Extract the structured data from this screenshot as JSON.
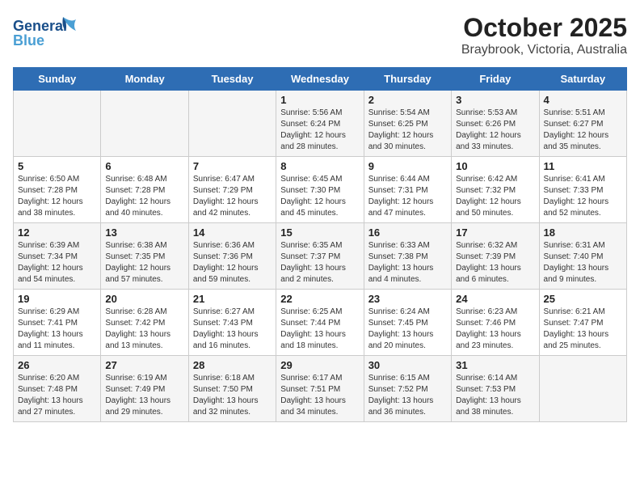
{
  "header": {
    "logo_general": "General",
    "logo_blue": "Blue",
    "title": "October 2025",
    "subtitle": "Braybrook, Victoria, Australia"
  },
  "days_of_week": [
    "Sunday",
    "Monday",
    "Tuesday",
    "Wednesday",
    "Thursday",
    "Friday",
    "Saturday"
  ],
  "weeks": [
    [
      {
        "day": "",
        "info": ""
      },
      {
        "day": "",
        "info": ""
      },
      {
        "day": "",
        "info": ""
      },
      {
        "day": "1",
        "info": "Sunrise: 5:56 AM\nSunset: 6:24 PM\nDaylight: 12 hours\nand 28 minutes."
      },
      {
        "day": "2",
        "info": "Sunrise: 5:54 AM\nSunset: 6:25 PM\nDaylight: 12 hours\nand 30 minutes."
      },
      {
        "day": "3",
        "info": "Sunrise: 5:53 AM\nSunset: 6:26 PM\nDaylight: 12 hours\nand 33 minutes."
      },
      {
        "day": "4",
        "info": "Sunrise: 5:51 AM\nSunset: 6:27 PM\nDaylight: 12 hours\nand 35 minutes."
      }
    ],
    [
      {
        "day": "5",
        "info": "Sunrise: 6:50 AM\nSunset: 7:28 PM\nDaylight: 12 hours\nand 38 minutes."
      },
      {
        "day": "6",
        "info": "Sunrise: 6:48 AM\nSunset: 7:28 PM\nDaylight: 12 hours\nand 40 minutes."
      },
      {
        "day": "7",
        "info": "Sunrise: 6:47 AM\nSunset: 7:29 PM\nDaylight: 12 hours\nand 42 minutes."
      },
      {
        "day": "8",
        "info": "Sunrise: 6:45 AM\nSunset: 7:30 PM\nDaylight: 12 hours\nand 45 minutes."
      },
      {
        "day": "9",
        "info": "Sunrise: 6:44 AM\nSunset: 7:31 PM\nDaylight: 12 hours\nand 47 minutes."
      },
      {
        "day": "10",
        "info": "Sunrise: 6:42 AM\nSunset: 7:32 PM\nDaylight: 12 hours\nand 50 minutes."
      },
      {
        "day": "11",
        "info": "Sunrise: 6:41 AM\nSunset: 7:33 PM\nDaylight: 12 hours\nand 52 minutes."
      }
    ],
    [
      {
        "day": "12",
        "info": "Sunrise: 6:39 AM\nSunset: 7:34 PM\nDaylight: 12 hours\nand 54 minutes."
      },
      {
        "day": "13",
        "info": "Sunrise: 6:38 AM\nSunset: 7:35 PM\nDaylight: 12 hours\nand 57 minutes."
      },
      {
        "day": "14",
        "info": "Sunrise: 6:36 AM\nSunset: 7:36 PM\nDaylight: 12 hours\nand 59 minutes."
      },
      {
        "day": "15",
        "info": "Sunrise: 6:35 AM\nSunset: 7:37 PM\nDaylight: 13 hours\nand 2 minutes."
      },
      {
        "day": "16",
        "info": "Sunrise: 6:33 AM\nSunset: 7:38 PM\nDaylight: 13 hours\nand 4 minutes."
      },
      {
        "day": "17",
        "info": "Sunrise: 6:32 AM\nSunset: 7:39 PM\nDaylight: 13 hours\nand 6 minutes."
      },
      {
        "day": "18",
        "info": "Sunrise: 6:31 AM\nSunset: 7:40 PM\nDaylight: 13 hours\nand 9 minutes."
      }
    ],
    [
      {
        "day": "19",
        "info": "Sunrise: 6:29 AM\nSunset: 7:41 PM\nDaylight: 13 hours\nand 11 minutes."
      },
      {
        "day": "20",
        "info": "Sunrise: 6:28 AM\nSunset: 7:42 PM\nDaylight: 13 hours\nand 13 minutes."
      },
      {
        "day": "21",
        "info": "Sunrise: 6:27 AM\nSunset: 7:43 PM\nDaylight: 13 hours\nand 16 minutes."
      },
      {
        "day": "22",
        "info": "Sunrise: 6:25 AM\nSunset: 7:44 PM\nDaylight: 13 hours\nand 18 minutes."
      },
      {
        "day": "23",
        "info": "Sunrise: 6:24 AM\nSunset: 7:45 PM\nDaylight: 13 hours\nand 20 minutes."
      },
      {
        "day": "24",
        "info": "Sunrise: 6:23 AM\nSunset: 7:46 PM\nDaylight: 13 hours\nand 23 minutes."
      },
      {
        "day": "25",
        "info": "Sunrise: 6:21 AM\nSunset: 7:47 PM\nDaylight: 13 hours\nand 25 minutes."
      }
    ],
    [
      {
        "day": "26",
        "info": "Sunrise: 6:20 AM\nSunset: 7:48 PM\nDaylight: 13 hours\nand 27 minutes."
      },
      {
        "day": "27",
        "info": "Sunrise: 6:19 AM\nSunset: 7:49 PM\nDaylight: 13 hours\nand 29 minutes."
      },
      {
        "day": "28",
        "info": "Sunrise: 6:18 AM\nSunset: 7:50 PM\nDaylight: 13 hours\nand 32 minutes."
      },
      {
        "day": "29",
        "info": "Sunrise: 6:17 AM\nSunset: 7:51 PM\nDaylight: 13 hours\nand 34 minutes."
      },
      {
        "day": "30",
        "info": "Sunrise: 6:15 AM\nSunset: 7:52 PM\nDaylight: 13 hours\nand 36 minutes."
      },
      {
        "day": "31",
        "info": "Sunrise: 6:14 AM\nSunset: 7:53 PM\nDaylight: 13 hours\nand 38 minutes."
      },
      {
        "day": "",
        "info": ""
      }
    ]
  ]
}
